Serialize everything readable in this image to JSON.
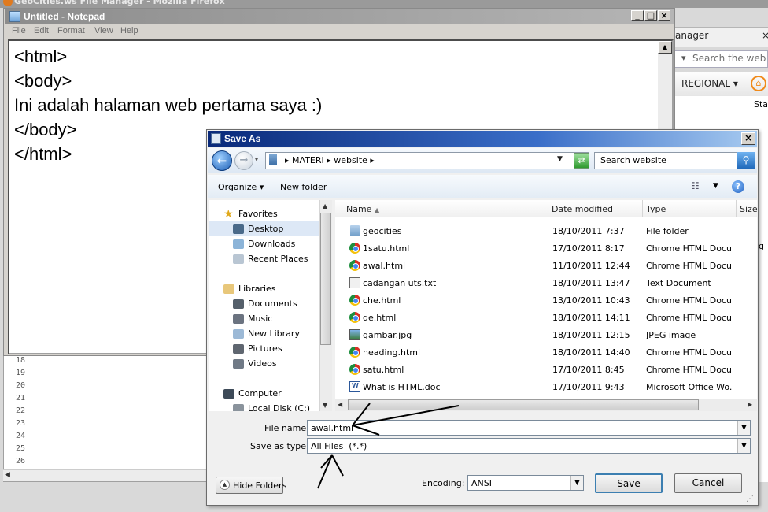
{
  "browser": {
    "title": "GeoCities.ws File Manager - Mozilla Firefox",
    "tab_label": "anager",
    "tab_close": "×",
    "search_placeholder": "Search the web",
    "toolbar_item": "REGIONAL",
    "page_fragment_1": "Sta",
    "page_fragment_2": "g"
  },
  "editor": {
    "line_numbers": [
      "18",
      "19",
      "20",
      "21",
      "22",
      "23",
      "24",
      "25",
      "26"
    ]
  },
  "notepad": {
    "title": "Untitled - Notepad",
    "menu": [
      "File",
      "Edit",
      "Format",
      "View",
      "Help"
    ],
    "content_lines": [
      "<html>",
      "<body>",
      "Ini adalah halaman web pertama saya :)",
      "</body>",
      "</html>"
    ]
  },
  "save_dialog": {
    "title": "Save As",
    "address_path": [
      "MATERI",
      "website"
    ],
    "search_placeholder": "Search website",
    "organize_label": "Organize",
    "new_folder_label": "New folder",
    "nav_pane": {
      "favorites_header": "Favorites",
      "favorites": [
        "Desktop",
        "Downloads",
        "Recent Places"
      ],
      "libraries_header": "Libraries",
      "libraries": [
        "Documents",
        "Music",
        "New Library",
        "Pictures",
        "Videos"
      ],
      "computer_header": "Computer",
      "computer": [
        "Local Disk (C:)"
      ]
    },
    "columns": [
      "Name",
      "Date modified",
      "Type",
      "Size"
    ],
    "files": [
      {
        "name": "geocities",
        "date": "18/10/2011 7:37",
        "type": "File folder",
        "icon": "folder-icon"
      },
      {
        "name": "1satu.html",
        "date": "17/10/2011 8:17",
        "type": "Chrome HTML Docu...",
        "icon": "chrome-icon"
      },
      {
        "name": "awal.html",
        "date": "11/10/2011 12:44",
        "type": "Chrome HTML Docu...",
        "icon": "chrome-icon"
      },
      {
        "name": "cadangan uts.txt",
        "date": "18/10/2011 13:47",
        "type": "Text Document",
        "icon": "text-file-icon"
      },
      {
        "name": "che.html",
        "date": "13/10/2011 10:43",
        "type": "Chrome HTML Docu...",
        "icon": "chrome-icon"
      },
      {
        "name": "de.html",
        "date": "18/10/2011 14:11",
        "type": "Chrome HTML Docu...",
        "icon": "chrome-icon"
      },
      {
        "name": "gambar.jpg",
        "date": "18/10/2011 12:15",
        "type": "JPEG image",
        "icon": "image-file-icon"
      },
      {
        "name": "heading.html",
        "date": "18/10/2011 14:40",
        "type": "Chrome HTML Docu...",
        "icon": "chrome-icon"
      },
      {
        "name": "satu.html",
        "date": "17/10/2011 8:45",
        "type": "Chrome HTML Docu...",
        "icon": "chrome-icon"
      },
      {
        "name": "What is HTML.doc",
        "date": "17/10/2011 9:43",
        "type": "Microsoft Office Wo...",
        "icon": "word-doc-icon"
      }
    ],
    "file_name_label": "File name:",
    "file_name_value": "awal.html",
    "save_type_label": "Save as type:",
    "save_type_value": "All Files  (*.*)",
    "hide_folders_label": "Hide Folders",
    "encoding_label": "Encoding:",
    "encoding_value": "ANSI",
    "save_label": "Save",
    "cancel_label": "Cancel"
  },
  "colors": {
    "dialog_title_start": "#0a2a7a",
    "dialog_title_end": "#a6caf0",
    "annotation_arrow": "#000000"
  }
}
